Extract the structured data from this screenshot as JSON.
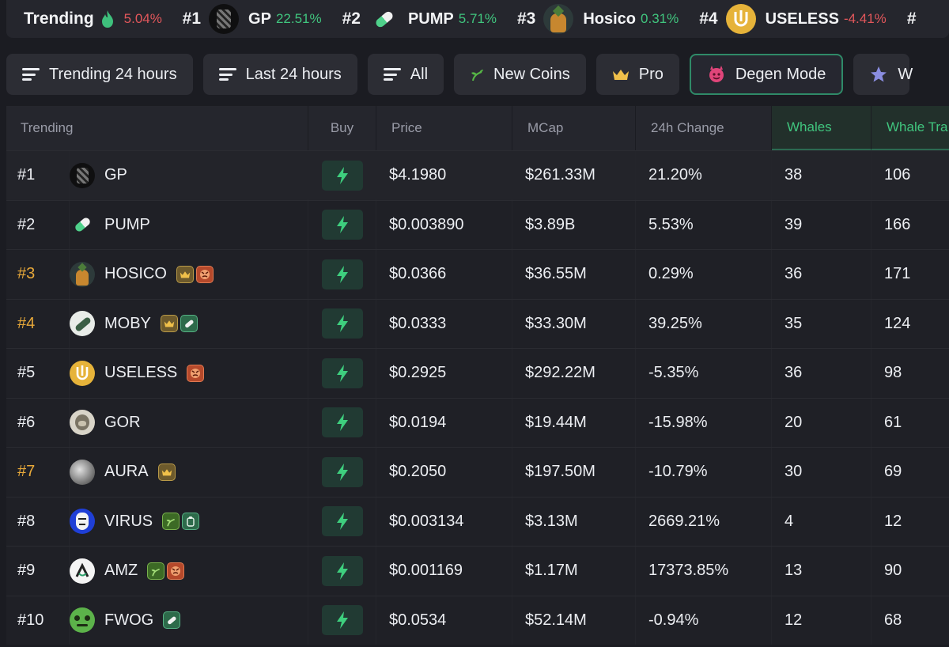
{
  "ticker": {
    "title": "Trending",
    "fragment": "5.04%",
    "items": [
      {
        "rank": "#1",
        "symbol": "GP",
        "change": "22.51%",
        "dir": "pos"
      },
      {
        "rank": "#2",
        "symbol": "PUMP",
        "change": "5.71%",
        "dir": "pos"
      },
      {
        "rank": "#3",
        "symbol": "Hosico",
        "change": "0.31%",
        "dir": "pos"
      },
      {
        "rank": "#4",
        "symbol": "USELESS",
        "change": "-4.41%",
        "dir": "neg"
      },
      {
        "rank": "#",
        "symbol": "",
        "change": "",
        "dir": "pos"
      }
    ]
  },
  "filters": [
    {
      "label": "Trending 24 hours",
      "icon": "sort-icon"
    },
    {
      "label": "Last 24 hours",
      "icon": "sort-icon"
    },
    {
      "label": "All",
      "icon": "sort-icon"
    },
    {
      "label": "New Coins",
      "icon": "sprout-icon"
    },
    {
      "label": "Pro",
      "icon": "crown-icon"
    },
    {
      "label": "Degen Mode",
      "icon": "devil-icon"
    },
    {
      "label": "W",
      "icon": "star-icon"
    }
  ],
  "table": {
    "headers": {
      "trending": "Trending",
      "buy": "Buy",
      "price": "Price",
      "mcap": "MCap",
      "change": "24h Change",
      "whales": "Whales",
      "whale_trades": "Whale Tra"
    },
    "rows": [
      {
        "rank": "#1",
        "gold": false,
        "symbol": "GP",
        "badges": [],
        "price": "$4.1980",
        "mcap": "$261.33M",
        "change": "21.20%",
        "dir": "pos",
        "whales": "38",
        "trades": "106"
      },
      {
        "rank": "#2",
        "gold": false,
        "symbol": "PUMP",
        "badges": [],
        "price": "$0.003890",
        "mcap": "$3.89B",
        "change": "5.53%",
        "dir": "pos",
        "whales": "39",
        "trades": "166"
      },
      {
        "rank": "#3",
        "gold": true,
        "symbol": "HOSICO",
        "badges": [
          "crown",
          "angry"
        ],
        "price": "$0.0366",
        "mcap": "$36.55M",
        "change": "0.29%",
        "dir": "pos",
        "whales": "36",
        "trades": "171"
      },
      {
        "rank": "#4",
        "gold": true,
        "symbol": "MOBY",
        "badges": [
          "crown",
          "pill"
        ],
        "price": "$0.0333",
        "mcap": "$33.30M",
        "change": "39.25%",
        "dir": "pos",
        "whales": "35",
        "trades": "124"
      },
      {
        "rank": "#5",
        "gold": false,
        "symbol": "USELESS",
        "badges": [
          "angry"
        ],
        "price": "$0.2925",
        "mcap": "$292.22M",
        "change": "-5.35%",
        "dir": "neg",
        "whales": "36",
        "trades": "98"
      },
      {
        "rank": "#6",
        "gold": false,
        "symbol": "GOR",
        "badges": [],
        "price": "$0.0194",
        "mcap": "$19.44M",
        "change": "-15.98%",
        "dir": "neg",
        "whales": "20",
        "trades": "61"
      },
      {
        "rank": "#7",
        "gold": true,
        "symbol": "AURA",
        "badges": [
          "crown"
        ],
        "price": "$0.2050",
        "mcap": "$197.50M",
        "change": "-10.79%",
        "dir": "neg",
        "whales": "30",
        "trades": "69"
      },
      {
        "rank": "#8",
        "gold": false,
        "symbol": "VIRUS",
        "badges": [
          "sprout",
          "clip"
        ],
        "price": "$0.003134",
        "mcap": "$3.13M",
        "change": "2669.21%",
        "dir": "pos",
        "whales": "4",
        "trades": "12"
      },
      {
        "rank": "#9",
        "gold": false,
        "symbol": "AMZ",
        "badges": [
          "sprout",
          "angry"
        ],
        "price": "$0.001169",
        "mcap": "$1.17M",
        "change": "17373.85%",
        "dir": "pos",
        "whales": "13",
        "trades": "90"
      },
      {
        "rank": "#10",
        "gold": false,
        "symbol": "FWOG",
        "badges": [
          "pill"
        ],
        "price": "$0.0534",
        "mcap": "$52.14M",
        "change": "-0.94%",
        "dir": "neg",
        "whales": "12",
        "trades": "68"
      }
    ]
  },
  "colors": {
    "positive": "#40c57e",
    "negative": "#e2575b",
    "gold_rank": "#e8a93a",
    "accent": "#2f8a68"
  }
}
